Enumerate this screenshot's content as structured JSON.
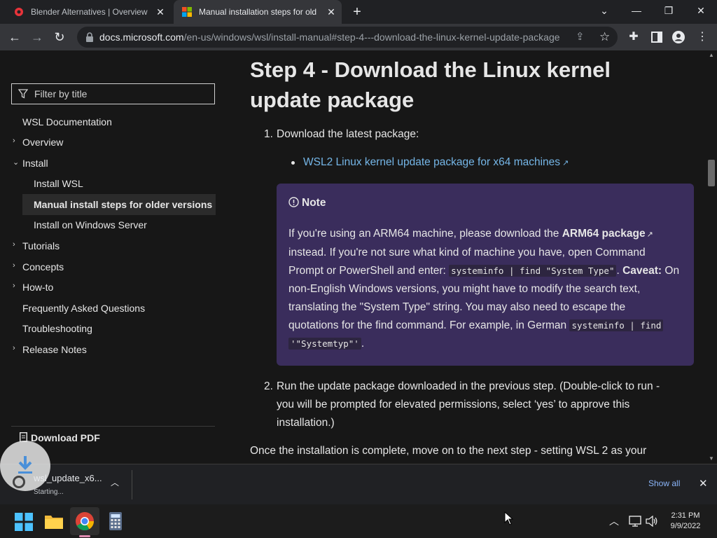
{
  "browser": {
    "tabs": [
      {
        "title": "Blender Alternatives | Overview A",
        "close": "✕"
      },
      {
        "title": "Manual installation steps for olde",
        "close": "✕"
      }
    ],
    "new_tab": "+",
    "window_controls": {
      "tab_search": "⌄",
      "minimize": "—",
      "restore": "❐",
      "close": "✕"
    },
    "address": {
      "domain": "docs.microsoft.com",
      "path": "/en-us/windows/wsl/install-manual#step-4---download-the-linux-kernel-update-package"
    }
  },
  "sidebar": {
    "filter_placeholder": "Filter by title",
    "items": [
      {
        "label": "WSL Documentation",
        "chevron": ""
      },
      {
        "label": "Overview",
        "chevron": "›"
      },
      {
        "label": "Install",
        "chevron": "⌄"
      },
      {
        "label": "Install WSL",
        "chevron": ""
      },
      {
        "label": "Manual install steps for older versions",
        "chevron": ""
      },
      {
        "label": "Install on Windows Server",
        "chevron": ""
      },
      {
        "label": "Tutorials",
        "chevron": "›"
      },
      {
        "label": "Concepts",
        "chevron": "›"
      },
      {
        "label": "How-to",
        "chevron": "›"
      },
      {
        "label": "Frequently Asked Questions",
        "chevron": ""
      },
      {
        "label": "Troubleshooting",
        "chevron": ""
      },
      {
        "label": "Release Notes",
        "chevron": "›"
      }
    ],
    "download_pdf": "Download PDF"
  },
  "article": {
    "heading_line1": "Step 4 - Download the Linux kernel",
    "heading_line2": "update package",
    "step1_num": "1.",
    "step1": "Download the latest package:",
    "step1_link": "WSL2 Linux kernel update package for x64 machines",
    "note": {
      "title": "Note",
      "t1": "If you're using an ARM64 machine, please download the ",
      "arm_link": "ARM64 package",
      "t2": "instead. If you're not sure what kind of machine you have, open Command",
      "t3": "Prompt or PowerShell and enter: ",
      "code1": "systeminfo | find \"System Type\"",
      "t4": ". ",
      "caveat": "Caveat:",
      "t5": " On",
      "t6": "non-English Windows versions, you might have to modify the search text,",
      "t7": "translating the \"System Type\" string. You may also need to escape the",
      "t8": "quotations for the find command. For example, in German ",
      "code2a": "systeminfo | find",
      "code2b": "'\"Systemtyp\"'",
      "t9": "."
    },
    "step2_num": "2.",
    "step2_l1": "Run the update package downloaded in the previous step. (Double-click to run -",
    "step2_l2": "you will be prompted for elevated permissions, select ‘yes’ to approve this",
    "step2_l3": "installation.)",
    "after": "Once the installation is complete, move on to the next step - setting WSL 2 as your"
  },
  "downloads": {
    "filename": "wsl_update_x6...",
    "status": "Starting...",
    "show_all": "Show all",
    "close": "✕"
  },
  "taskbar": {
    "time": "2:31 PM",
    "date": "9/9/2022"
  }
}
